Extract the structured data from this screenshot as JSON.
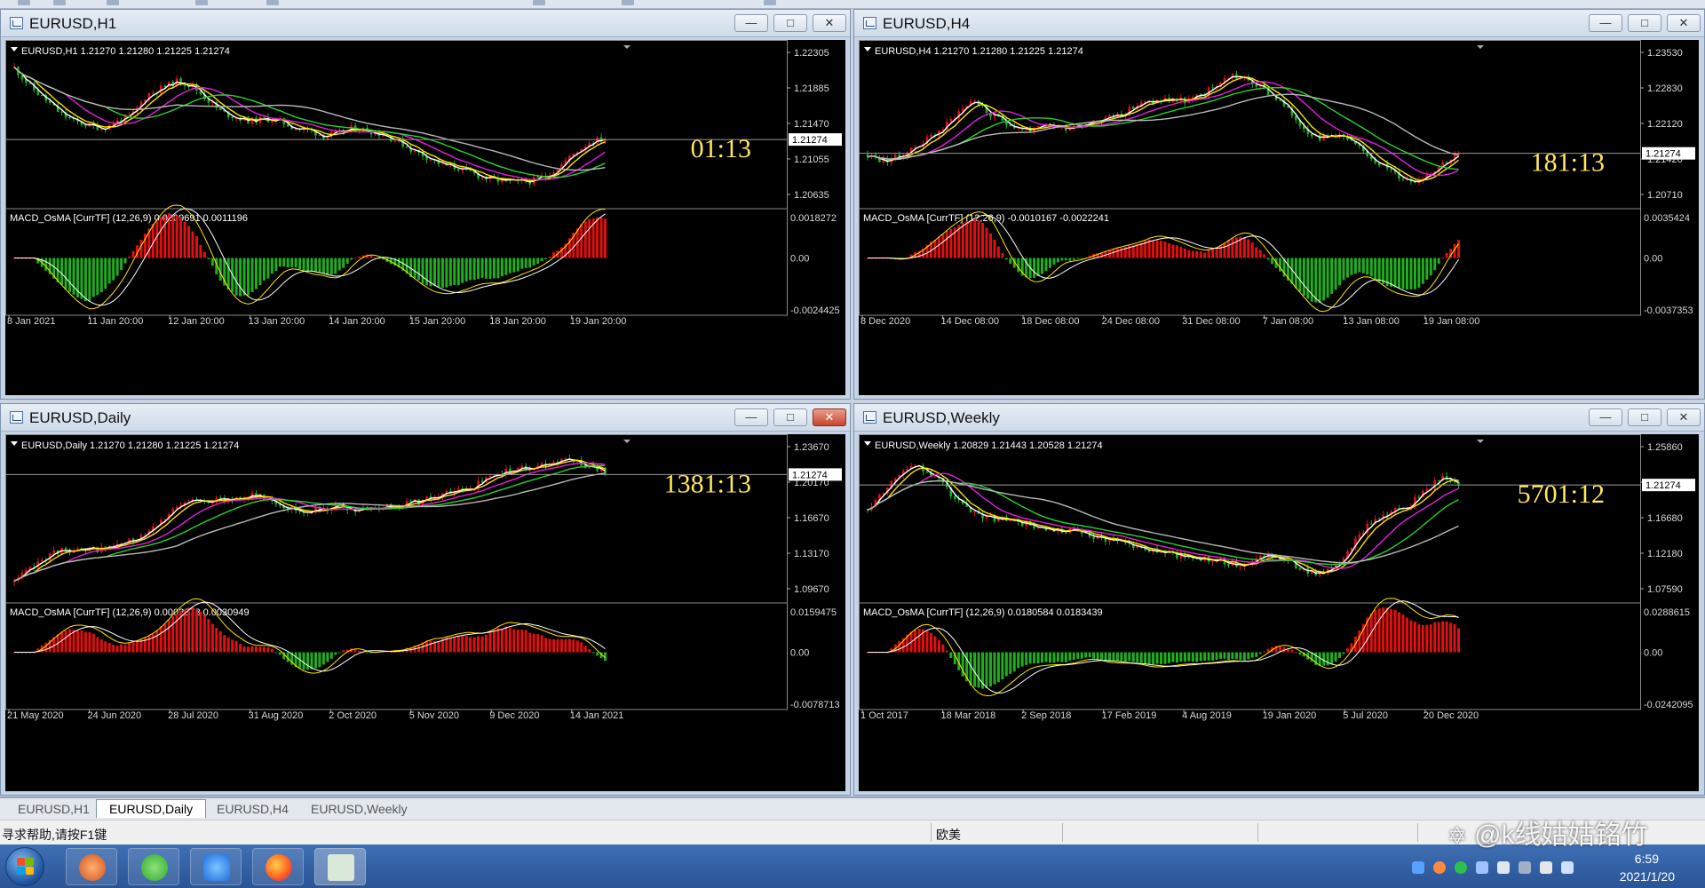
{
  "app": {
    "status_help": "寻求帮助,请按F1键",
    "status_profile": "欧美"
  },
  "colors": {
    "bull": "#e01010",
    "bear": "#1fae1f",
    "ma_white": "#ffffff",
    "ma_yellow": "#ffe100",
    "ma_magenta": "#e020e0",
    "ma_green": "#2bd12b",
    "ma_gray": "#b8b8b8",
    "countdown": "#ffe75a",
    "axis_text": "#d8d8d8"
  },
  "windows": [
    {
      "id": "h1",
      "title": "EURUSD,H1",
      "close_style": "normal",
      "price_header": "EURUSD,H1  1.21270 1.21280 1.21225 1.21274",
      "countdown": "01:13",
      "price_axis": [
        "1.22305",
        "1.21885",
        "1.21470",
        "1.21055",
        "1.20635"
      ],
      "current_price": "1.21274",
      "macd_header": "MACD_OsMA [CurrTF] (12,26,9) 0.0009691 0.0011196",
      "macd_axis": [
        "0.0018272",
        "0.00",
        "-0.0024425"
      ],
      "time_axis": [
        "8 Jan 2021",
        "11 Jan 20:00",
        "12 Jan 20:00",
        "13 Jan 20:00",
        "14 Jan 20:00",
        "15 Jan 20:00",
        "18 Jan 20:00",
        "19 Jan 20:00"
      ],
      "path": [
        0.95,
        0.82,
        0.72,
        0.62,
        0.55,
        0.52,
        0.5,
        0.55,
        0.6,
        0.75,
        0.8,
        0.85,
        0.82,
        0.72,
        0.62,
        0.58,
        0.55,
        0.57,
        0.55,
        0.5,
        0.48,
        0.44,
        0.46,
        0.5,
        0.48,
        0.45,
        0.4,
        0.33,
        0.28,
        0.22,
        0.2,
        0.16,
        0.12,
        0.1,
        0.09,
        0.1,
        0.14,
        0.22,
        0.32,
        0.4,
        0.42
      ]
    },
    {
      "id": "h4",
      "title": "EURUSD,H4",
      "close_style": "normal",
      "price_header": "EURUSD,H4  1.21270 1.21280 1.21225 1.21274",
      "countdown": "181:13",
      "price_axis": [
        "1.23530",
        "1.22830",
        "1.22120",
        "1.21420",
        "1.20710"
      ],
      "current_price": "1.21274",
      "macd_header": "MACD_OsMA [CurrTF] (12,26,9) -0.0010167 -0.0022241",
      "macd_axis": [
        "0.0035424",
        "0.00",
        "-0.0037353"
      ],
      "time_axis": [
        "8 Dec 2020",
        "14 Dec 08:00",
        "18 Dec 08:00",
        "24 Dec 08:00",
        "31 Dec 08:00",
        "7 Jan 08:00",
        "13 Jan 08:00",
        "19 Jan 08:00"
      ],
      "path": [
        0.3,
        0.25,
        0.28,
        0.35,
        0.42,
        0.5,
        0.62,
        0.72,
        0.6,
        0.55,
        0.5,
        0.48,
        0.52,
        0.5,
        0.53,
        0.56,
        0.58,
        0.62,
        0.68,
        0.7,
        0.72,
        0.7,
        0.74,
        0.82,
        0.9,
        0.86,
        0.8,
        0.72,
        0.6,
        0.48,
        0.42,
        0.46,
        0.38,
        0.3,
        0.22,
        0.14,
        0.1,
        0.16,
        0.24,
        0.3
      ]
    },
    {
      "id": "daily",
      "title": "EURUSD,Daily",
      "close_style": "red",
      "price_header": "EURUSD,Daily  1.21270 1.21280 1.21225 1.21274",
      "countdown": "1381:13",
      "price_axis": [
        "1.23670",
        "1.20170",
        "1.16670",
        "1.13170",
        "1.09670"
      ],
      "current_price": "1.21274",
      "macd_header": "MACD_OsMA [CurrTF] (12,26,9) 0.0002373 0.0030949",
      "macd_axis": [
        "0.0159475",
        "0.00",
        "-0.0078713"
      ],
      "time_axis": [
        "21 May 2020",
        "24 Jun 2020",
        "28 Jul 2020",
        "31 Aug 2020",
        "2 Oct 2020",
        "5 Nov 2020",
        "9 Dec 2020",
        "14 Jan 2021"
      ],
      "path": [
        0.05,
        0.15,
        0.25,
        0.3,
        0.28,
        0.3,
        0.32,
        0.36,
        0.45,
        0.55,
        0.63,
        0.68,
        0.66,
        0.68,
        0.7,
        0.68,
        0.62,
        0.58,
        0.6,
        0.62,
        0.58,
        0.6,
        0.62,
        0.64,
        0.66,
        0.7,
        0.72,
        0.76,
        0.82,
        0.88,
        0.9,
        0.92,
        0.95,
        0.97,
        0.92,
        0.88
      ]
    },
    {
      "id": "weekly",
      "title": "EURUSD,Weekly",
      "close_style": "normal",
      "price_header": "EURUSD,Weekly  1.20829 1.21443 1.20528 1.21274",
      "countdown": "5701:12",
      "price_axis": [
        "1.25860",
        "1.21660",
        "1.16680",
        "1.12180",
        "1.07590"
      ],
      "current_price": "1.21274",
      "macd_header": "MACD_OsMA [CurrTF] (12,26,9) 0.0180584 0.0183439",
      "macd_axis": [
        "0.0288615",
        "0.00",
        "-0.0242095"
      ],
      "time_axis": [
        "1 Oct 2017",
        "18 Mar 2018",
        "2 Sep 2018",
        "17 Feb 2019",
        "4 Aug 2019",
        "19 Jan 2020",
        "5 Jul 2020",
        "20 Dec 2020"
      ],
      "path": [
        0.6,
        0.75,
        0.88,
        0.92,
        0.85,
        0.7,
        0.58,
        0.54,
        0.52,
        0.5,
        0.46,
        0.42,
        0.44,
        0.4,
        0.38,
        0.36,
        0.32,
        0.28,
        0.26,
        0.24,
        0.22,
        0.2,
        0.18,
        0.22,
        0.26,
        0.2,
        0.14,
        0.1,
        0.2,
        0.38,
        0.52,
        0.58,
        0.62,
        0.74,
        0.84,
        0.78
      ]
    }
  ],
  "tabs": [
    {
      "label": "EURUSD,H1",
      "active": false
    },
    {
      "label": "EURUSD,Daily",
      "active": true
    },
    {
      "label": "EURUSD,H4",
      "active": false
    },
    {
      "label": "EURUSD,Weekly",
      "active": false
    }
  ],
  "taskbar": {
    "time": "6:59",
    "date": "2021/1/20"
  },
  "watermark": "@k线姑姑铭竹"
}
